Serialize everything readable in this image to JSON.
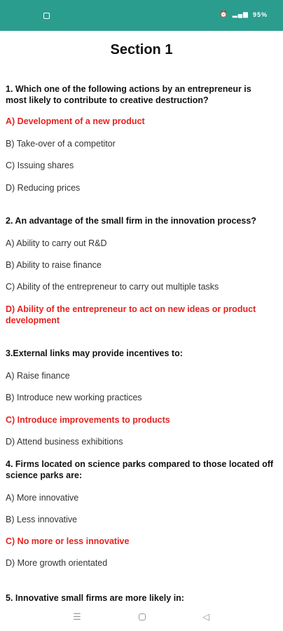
{
  "status_bar": {
    "icons": [
      "alarm-icon",
      "data-icon",
      "volte-icon",
      "wifi-icon",
      "signal-icon"
    ],
    "battery": "95%"
  },
  "page": {
    "title": "Section 1"
  },
  "questions": [
    {
      "text": "1. Which one of the following actions by an entrepreneur is most likely to contribute to creative destruction?",
      "options": [
        {
          "text": "A) Development of a new product",
          "correct": true
        },
        {
          "text": "B) Take-over of a competitor",
          "correct": false
        },
        {
          "text": "C) Issuing shares",
          "correct": false
        },
        {
          "text": "D) Reducing prices",
          "correct": false
        }
      ]
    },
    {
      "text": "2. An advantage of the small firm in the innovation process?",
      "options": [
        {
          "text": "A) Ability to carry out R&D",
          "correct": false
        },
        {
          "text": "B) Ability to raise finance",
          "correct": false
        },
        {
          "text": "C) Ability of the entrepreneur to carry out multiple tasks",
          "correct": false
        },
        {
          "text": "D) Ability of the entrepreneur to act on new ideas or product development",
          "correct": true
        }
      ]
    },
    {
      "text": "3.External links may provide incentives to:",
      "options": [
        {
          "text": "A) Raise finance",
          "correct": false
        },
        {
          "text": "B) Introduce new working practices",
          "correct": false
        },
        {
          "text": "C) Introduce improvements to products",
          "correct": true
        },
        {
          "text": "D) Attend business exhibitions",
          "correct": false
        }
      ]
    },
    {
      "text": "4. Firms located on science parks compared to those located off science parks are:",
      "options": [
        {
          "text": "A) More innovative",
          "correct": false
        },
        {
          "text": "B) Less innovative",
          "correct": false
        },
        {
          "text": "C) No more or less innovative",
          "correct": true
        },
        {
          "text": "D) More growth orientated",
          "correct": false
        }
      ]
    },
    {
      "text": "5. Innovative small firms are more likely in:",
      "options": []
    }
  ],
  "colors": {
    "status_bar": "#2a9d8f",
    "correct_answer": "#e8221f"
  },
  "nav_bar": {
    "icons": [
      "menu-icon",
      "home-icon",
      "back-icon"
    ]
  }
}
